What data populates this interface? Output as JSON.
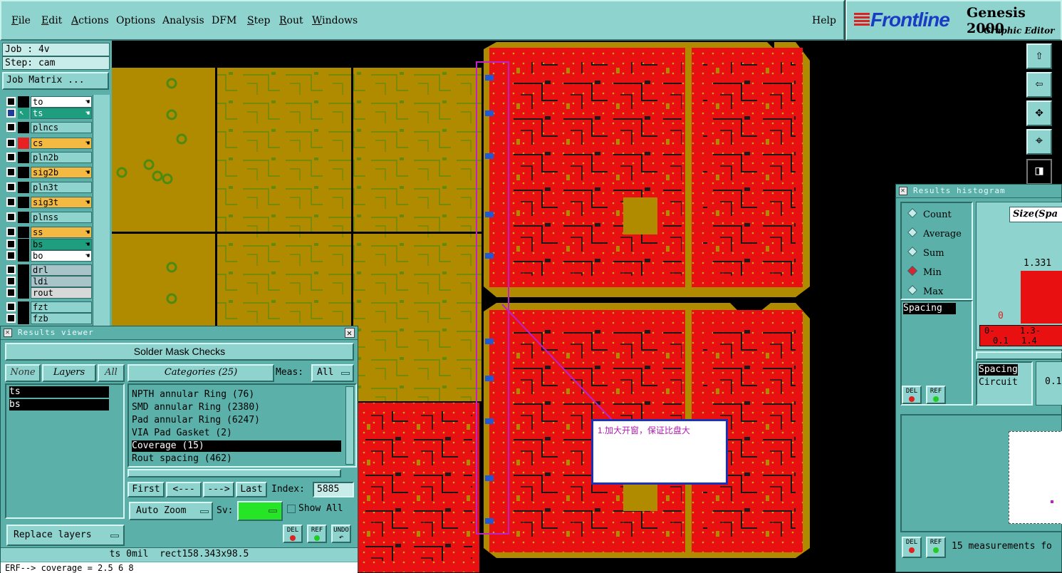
{
  "menu": {
    "items": [
      "File",
      "Edit",
      "Actions",
      "Options",
      "Analysis",
      "DFM",
      "Step",
      "Rout",
      "Windows"
    ],
    "help": "Help"
  },
  "brand": {
    "logo": "Frontline",
    "product": "Genesis 2000",
    "subtitle": "Graphic Editor"
  },
  "job": {
    "job_line": "Job : 4v",
    "step_line": "Step: cam",
    "matrix_button": "Job Matrix ..."
  },
  "layers": [
    {
      "name": "to",
      "color": "#ffffff",
      "swatch": "#000000",
      "on": false,
      "hand": true
    },
    {
      "name": "ts",
      "color": "#1e9e7e",
      "swatch": "#1e9e7e",
      "on": true,
      "hand": true,
      "text_color": "#ffffff"
    },
    {
      "name": "plncs",
      "color": "#8fd3cf",
      "swatch": "#000000",
      "on": false,
      "hand": false
    },
    {
      "name": "cs",
      "color": "#f4b942",
      "swatch": "#e82222",
      "on": false,
      "hand": true
    },
    {
      "name": "pln2b",
      "color": "#8fd3cf",
      "swatch": "#000000",
      "on": false,
      "hand": false
    },
    {
      "name": "sig2b",
      "color": "#f4b942",
      "swatch": "#000000",
      "on": false,
      "hand": true
    },
    {
      "name": "pln3t",
      "color": "#8fd3cf",
      "swatch": "#000000",
      "on": false,
      "hand": false
    },
    {
      "name": "sig3t",
      "color": "#f4b942",
      "swatch": "#000000",
      "on": false,
      "hand": true
    },
    {
      "name": "plnss",
      "color": "#8fd3cf",
      "swatch": "#000000",
      "on": false,
      "hand": false
    },
    {
      "name": "ss",
      "color": "#f4b942",
      "swatch": "#000000",
      "on": false,
      "hand": true
    },
    {
      "name": "bs",
      "color": "#1e9e7e",
      "swatch": "#000000",
      "on": false,
      "hand": true
    },
    {
      "name": "bo",
      "color": "#ffffff",
      "swatch": "#000000",
      "on": false,
      "hand": true
    },
    {
      "name": "drl",
      "color": "#a9c4c8",
      "swatch": "#000000",
      "on": false,
      "hand": false
    },
    {
      "name": "ldi",
      "color": "#a9c4c8",
      "swatch": "#000000",
      "on": false,
      "hand": false
    },
    {
      "name": "rout",
      "color": "#d8d8d8",
      "swatch": "#000000",
      "on": false,
      "hand": false
    },
    {
      "name": "fzt",
      "color": "#8fd3cf",
      "swatch": "#000000",
      "on": false,
      "hand": false
    },
    {
      "name": "fzb",
      "color": "#8fd3cf",
      "swatch": "#000000",
      "on": false,
      "hand": false
    }
  ],
  "results_viewer": {
    "title": "Results viewer",
    "header": "Solder Mask Checks",
    "none_btn": "None",
    "layers_btn": "Layers",
    "all_btn": "All",
    "categories_btn": "Categories (25)",
    "meas_label": "Meas:",
    "meas_value": "All",
    "layer_items": [
      "ts",
      "bs"
    ],
    "categories": [
      {
        "label": "NPTH annular Ring (76)",
        "selected": false
      },
      {
        "label": "SMD annular Ring (2380)",
        "selected": false
      },
      {
        "label": "Pad annular Ring (6247)",
        "selected": false
      },
      {
        "label": "VIA Pad Gasket (2)",
        "selected": false
      },
      {
        "label": "Coverage (15)",
        "selected": true
      },
      {
        "label": "Rout spacing (462)",
        "selected": false
      }
    ],
    "nav": {
      "first": "First",
      "prev": "<---",
      "next": "--->",
      "last": "Last",
      "index_label": "Index:",
      "index_value": "5885"
    },
    "zoom": "Auto Zoom",
    "sv_label": "Sv:",
    "show_all": "Show All",
    "replace_layers": "Replace layers",
    "del": "DEL",
    "ref": "REF",
    "undo": "UNDO",
    "status": "ts 0mil  rect158.343x98.5",
    "erf": "ERF--> coverage = 2.5 6 8"
  },
  "results_histogram": {
    "title": "Results histogram",
    "options": [
      {
        "label": "Count",
        "on": false
      },
      {
        "label": "Average",
        "on": false
      },
      {
        "label": "Sum",
        "on": false
      },
      {
        "label": "Min",
        "on": true
      },
      {
        "label": "Max",
        "on": false
      }
    ],
    "list_sel": "Spacing",
    "size_label": "Size(Spa",
    "bar_value": "1.331",
    "zero_value": "0",
    "bin1_a": "0-",
    "bin1_b": "0.1",
    "bin2_a": "1.3-",
    "bin2_b": "1.4",
    "spacing_item": "Spacing",
    "circuit_item": "Circuit",
    "partial_value": "0.1",
    "del": "DEL",
    "ref": "REF",
    "footer": "15 measurements fo"
  },
  "annotation": {
    "text": "1.加大开窗，保证比盘大"
  },
  "colors": {
    "panel": "#5bb0aa",
    "button": "#8fd3cf",
    "copper": "#b08b00",
    "mask": "#e81010"
  }
}
